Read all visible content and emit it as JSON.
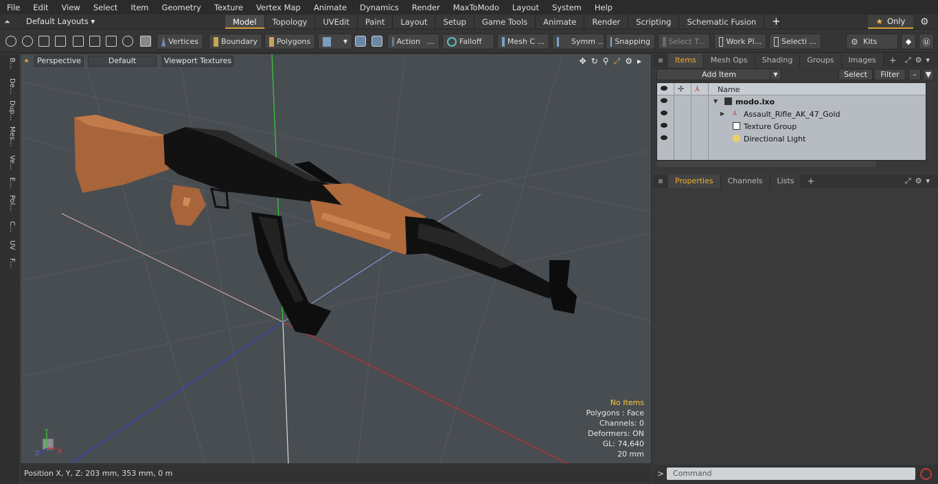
{
  "menu": [
    "File",
    "Edit",
    "View",
    "Select",
    "Item",
    "Geometry",
    "Texture",
    "Vertex Map",
    "Animate",
    "Dynamics",
    "Render",
    "MaxToModo",
    "Layout",
    "System",
    "Help"
  ],
  "layout_bar": {
    "layouts_label": "Default Layouts",
    "tabs": [
      "Model",
      "Topology",
      "UVEdit",
      "Paint",
      "Layout",
      "Setup",
      "Game Tools",
      "Animate",
      "Render",
      "Scripting",
      "Schematic Fusion"
    ],
    "active_tab": "Model",
    "add_tab": "+",
    "only_label": "Only"
  },
  "toolbar": {
    "vertices": "Vertices",
    "boundary": "Boundary",
    "polygons": "Polygons",
    "action": "Action",
    "falloff": "Falloff",
    "mesh_c": "Mesh C ...",
    "symm": "Symm ...",
    "snapping": "Snapping",
    "select_t": "Select T...",
    "work_pl": "Work Pl...",
    "selecti": "Selecti ...",
    "kits": "Kits"
  },
  "left_strip": [
    "B...",
    "De...",
    "Dup...",
    "Mes...",
    "Ve...",
    "E...",
    "Pol...",
    "C...",
    "UV",
    "F..."
  ],
  "viewport": {
    "view_mode": "Perspective",
    "shading": "Default",
    "textures": "Viewport Textures",
    "info": {
      "selection": "No Items",
      "polygons": "Polygons : Face",
      "channels": "Channels: 0",
      "deformers": "Deformers: ON",
      "gl": "GL: 74,640",
      "scale": "20 mm"
    },
    "axis_labels": {
      "x": "X",
      "y": "Y",
      "z": "Z"
    }
  },
  "status": {
    "position": "Position X, Y, Z:   203 mm, 353 mm, 0 m"
  },
  "items_panel": {
    "tabs": [
      "Items",
      "Mesh Ops",
      "Shading",
      "Groups",
      "Images"
    ],
    "active_tab": "Items",
    "add_item": "Add Item",
    "select_btn": "Select",
    "filter_btn": "Filter",
    "column_name": "Name",
    "rows": [
      {
        "label": "modo.lxo",
        "bold": true
      },
      {
        "label": "Assault_Rifle_AK_47_Gold",
        "bold": false
      },
      {
        "label": "Texture Group",
        "bold": false
      },
      {
        "label": "Directional Light",
        "bold": false
      }
    ]
  },
  "properties_panel": {
    "tabs": [
      "Properties",
      "Channels",
      "Lists"
    ],
    "active_tab": "Properties"
  },
  "command": {
    "prompt": ">",
    "placeholder": "Command"
  },
  "colors": {
    "accent": "#d7a33a",
    "viewport_bg": "#484d52",
    "wood": "#b06a3c",
    "metal": "#141414",
    "axis_x": "#c03030",
    "axis_y": "#30c030",
    "axis_z": "#3040c0"
  }
}
